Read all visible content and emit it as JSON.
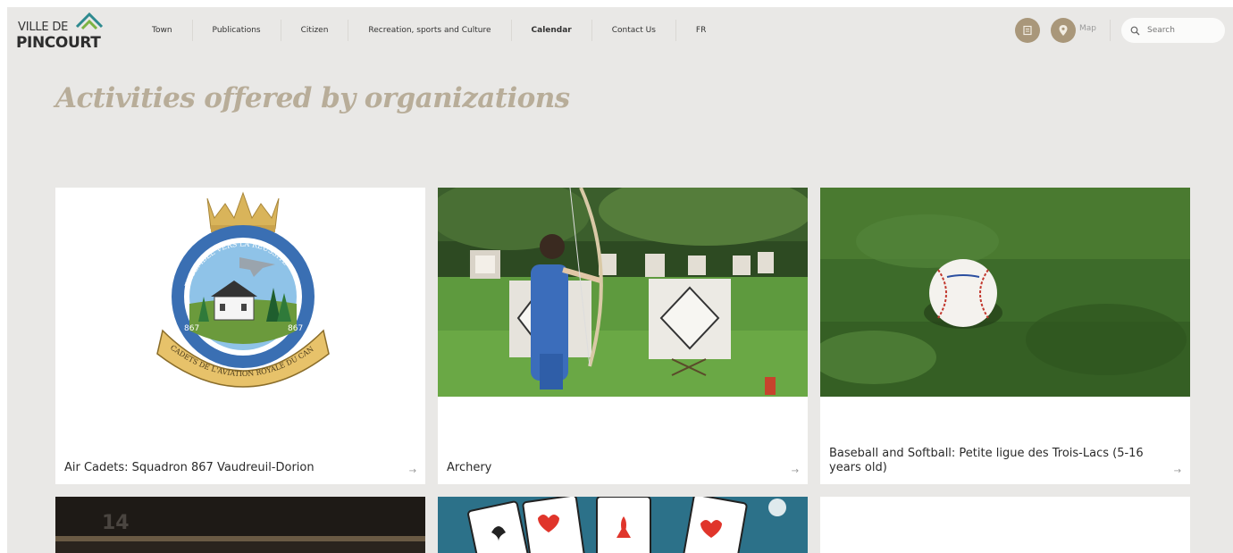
{
  "logo": {
    "line1": "VILLE DE",
    "line2": "PINCOURT"
  },
  "nav": [
    {
      "label": "Town"
    },
    {
      "label": "Publications"
    },
    {
      "label": "Citizen"
    },
    {
      "label": "Recreation, sports and Culture"
    },
    {
      "label": "Calendar"
    },
    {
      "label": "Contact Us"
    },
    {
      "label": "FR"
    }
  ],
  "header_tools": {
    "map_label": "Map",
    "search_placeholder": "Search"
  },
  "page_title": "Activities offered by organizations",
  "cards": [
    {
      "title": "Air Cadets: Squadron 867 Vaudreuil-Dorion",
      "arrow": "→"
    },
    {
      "title": "Archery",
      "arrow": "→"
    },
    {
      "title": "Baseball and Softball: Petite ligue des Trois-Lacs (5-16 years old)",
      "arrow": "→"
    }
  ],
  "crest": {
    "banner_text": "ENSEMBLE VERS LA RÉUSSITE",
    "left_number": "867",
    "right_number": "867",
    "scroll_text": "CADETS DE L'AVIATION ROYALE DU CANADA"
  },
  "partial_card": {
    "number": "14"
  },
  "colors": {
    "accent": "#a9977a",
    "title": "#b8ad99",
    "background": "#e9e8e6"
  }
}
